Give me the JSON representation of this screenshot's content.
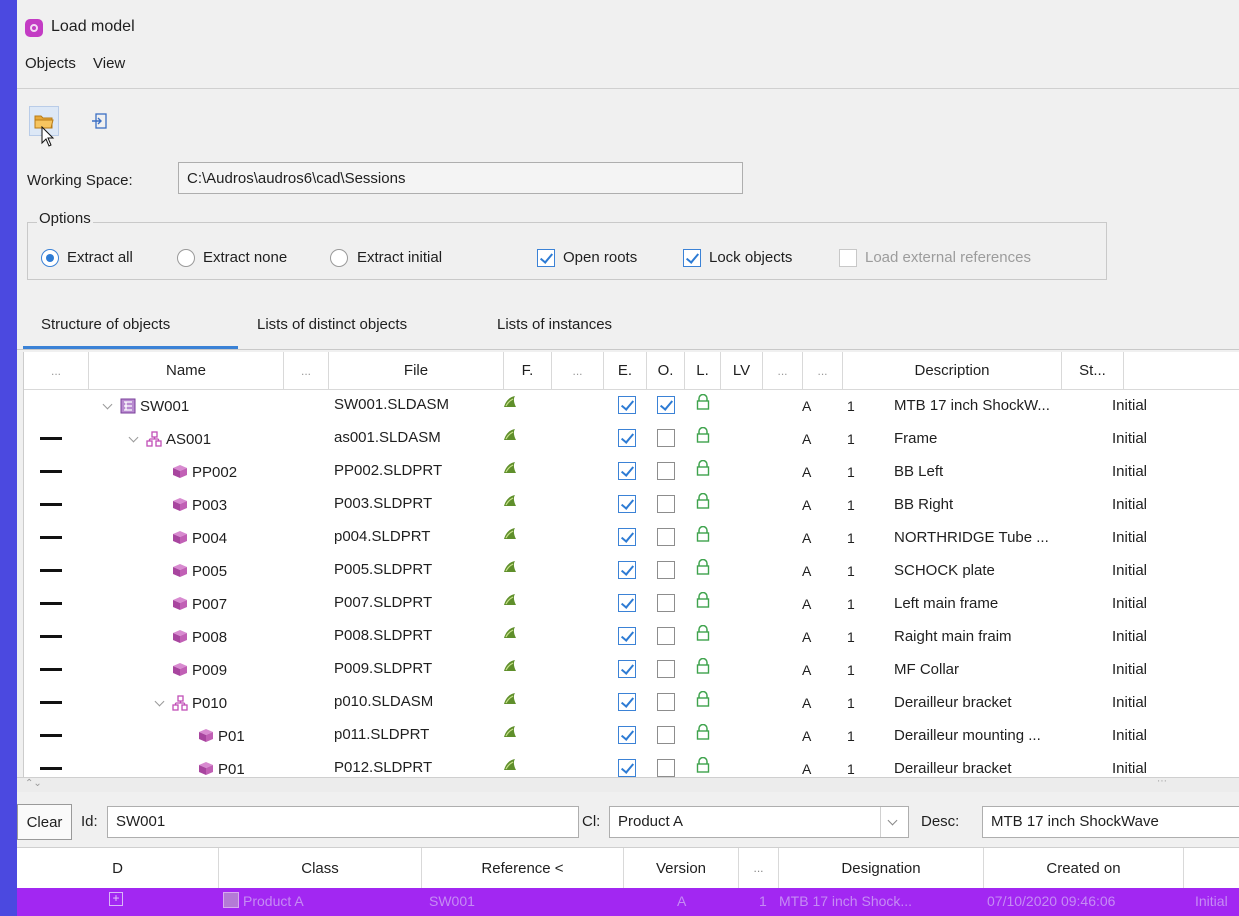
{
  "window": {
    "title": "Load model"
  },
  "menu": [
    "Objects",
    "View"
  ],
  "toolbar": {
    "open_icon": "folder-open-icon",
    "import_icon": "import-icon"
  },
  "working_space": {
    "label": "Working Space:",
    "value": "C:\\Audros\\audros6\\cad\\Sessions"
  },
  "options": {
    "legend": "Options",
    "extract_all": "Extract all",
    "extract_none": "Extract none",
    "extract_initial": "Extract initial",
    "open_roots": "Open roots",
    "lock_objects": "Lock objects",
    "load_external": "Load external references"
  },
  "tabs": [
    "Structure of objects",
    "Lists of distinct objects",
    "Lists of instances"
  ],
  "columns": [
    "...",
    "Name",
    "...",
    "File",
    "F.",
    "...",
    "E.",
    "O.",
    "L.",
    "LV",
    "...",
    "...",
    "Description",
    "St..."
  ],
  "rows": [
    {
      "name": "SW001",
      "file": "SW001.SLDASM",
      "e": true,
      "o": true,
      "rev": "A",
      "qty": "1",
      "desc": "MTB 17 inch ShockW...",
      "status": "Initial",
      "kind": "asm-root",
      "level": 0
    },
    {
      "name": "AS001",
      "file": "as001.SLDASM",
      "e": true,
      "o": false,
      "rev": "A",
      "qty": "1",
      "desc": "Frame",
      "status": "Initial",
      "kind": "asm",
      "level": 1
    },
    {
      "name": "PP002",
      "file": "PP002.SLDPRT",
      "e": true,
      "o": false,
      "rev": "A",
      "qty": "1",
      "desc": "BB Left",
      "status": "Initial",
      "kind": "part",
      "level": 2
    },
    {
      "name": "P003",
      "file": "P003.SLDPRT",
      "e": true,
      "o": false,
      "rev": "A",
      "qty": "1",
      "desc": "BB Right",
      "status": "Initial",
      "kind": "part",
      "level": 2
    },
    {
      "name": "P004",
      "file": "p004.SLDPRT",
      "e": true,
      "o": false,
      "rev": "A",
      "qty": "1",
      "desc": "NORTHRIDGE Tube ...",
      "status": "Initial",
      "kind": "part",
      "level": 2
    },
    {
      "name": "P005",
      "file": "P005.SLDPRT",
      "e": true,
      "o": false,
      "rev": "A",
      "qty": "1",
      "desc": "SCHOCK plate",
      "status": "Initial",
      "kind": "part",
      "level": 2
    },
    {
      "name": "P007",
      "file": "P007.SLDPRT",
      "e": true,
      "o": false,
      "rev": "A",
      "qty": "1",
      "desc": "Left main frame",
      "status": "Initial",
      "kind": "part",
      "level": 2
    },
    {
      "name": "P008",
      "file": "P008.SLDPRT",
      "e": true,
      "o": false,
      "rev": "A",
      "qty": "1",
      "desc": "Raight main fraim",
      "status": "Initial",
      "kind": "part",
      "level": 2
    },
    {
      "name": "P009",
      "file": "P009.SLDPRT",
      "e": true,
      "o": false,
      "rev": "A",
      "qty": "1",
      "desc": "MF Collar",
      "status": "Initial",
      "kind": "part",
      "level": 2
    },
    {
      "name": "P010",
      "file": "p010.SLDASM",
      "e": true,
      "o": false,
      "rev": "A",
      "qty": "1",
      "desc": "Derailleur bracket",
      "status": "Initial",
      "kind": "asm",
      "level": 2
    },
    {
      "name": "P01",
      "file": "p011.SLDPRT",
      "e": true,
      "o": false,
      "rev": "A",
      "qty": "1",
      "desc": "Derailleur mounting ...",
      "status": "Initial",
      "kind": "part",
      "level": 3
    },
    {
      "name": "P01",
      "file": "P012.SLDPRT",
      "e": true,
      "o": false,
      "rev": "A",
      "qty": "1",
      "desc": "Derailleur bracket",
      "status": "Initial",
      "kind": "part",
      "level": 3
    }
  ],
  "filter": {
    "clear": "Clear",
    "id_label": "Id:",
    "id_value": "SW001",
    "cl_label": "Cl:",
    "cl_value": "Product A",
    "desc_label": "Desc:",
    "desc_value": "MTB 17 inch ShockWave"
  },
  "bottom_columns": [
    "D",
    "Class",
    "Reference <",
    "Version",
    "...",
    "Designation",
    "Created on"
  ],
  "bottom_row": {
    "class": "Product A",
    "reference": "SW001",
    "version": "A",
    "num": "1",
    "designation": "MTB 17 inch Shock...",
    "created": "07/10/2020 09:46:06",
    "status": "Initial"
  },
  "colors": {
    "selection": "#a227f2",
    "accent": "#2d7bd4",
    "background": "#4b49e0"
  }
}
